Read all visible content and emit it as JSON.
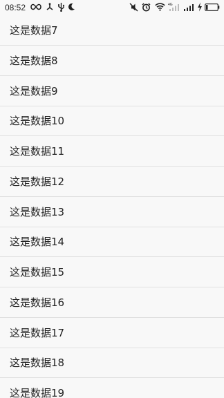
{
  "status_bar": {
    "time": "08:52",
    "left_icons": [
      "infinity-icon",
      "usb-share-icon",
      "usb-icon",
      "moon-icon"
    ],
    "right_icons": [
      "vibrate-off-icon",
      "alarm-icon",
      "wifi-icon",
      "signal-4g-icon",
      "signal-icon",
      "charging-icon",
      "battery-icon"
    ],
    "battery_level": 0.15
  },
  "list": {
    "items": [
      {
        "label": "这是数据7"
      },
      {
        "label": "这是数据8"
      },
      {
        "label": "这是数据9"
      },
      {
        "label": "这是数据10"
      },
      {
        "label": "这是数据11"
      },
      {
        "label": "这是数据12"
      },
      {
        "label": "这是数据13"
      },
      {
        "label": "这是数据14"
      },
      {
        "label": "这是数据15"
      },
      {
        "label": "这是数据16"
      },
      {
        "label": "这是数据17"
      },
      {
        "label": "这是数据18"
      },
      {
        "label": "这是数据19"
      }
    ]
  }
}
